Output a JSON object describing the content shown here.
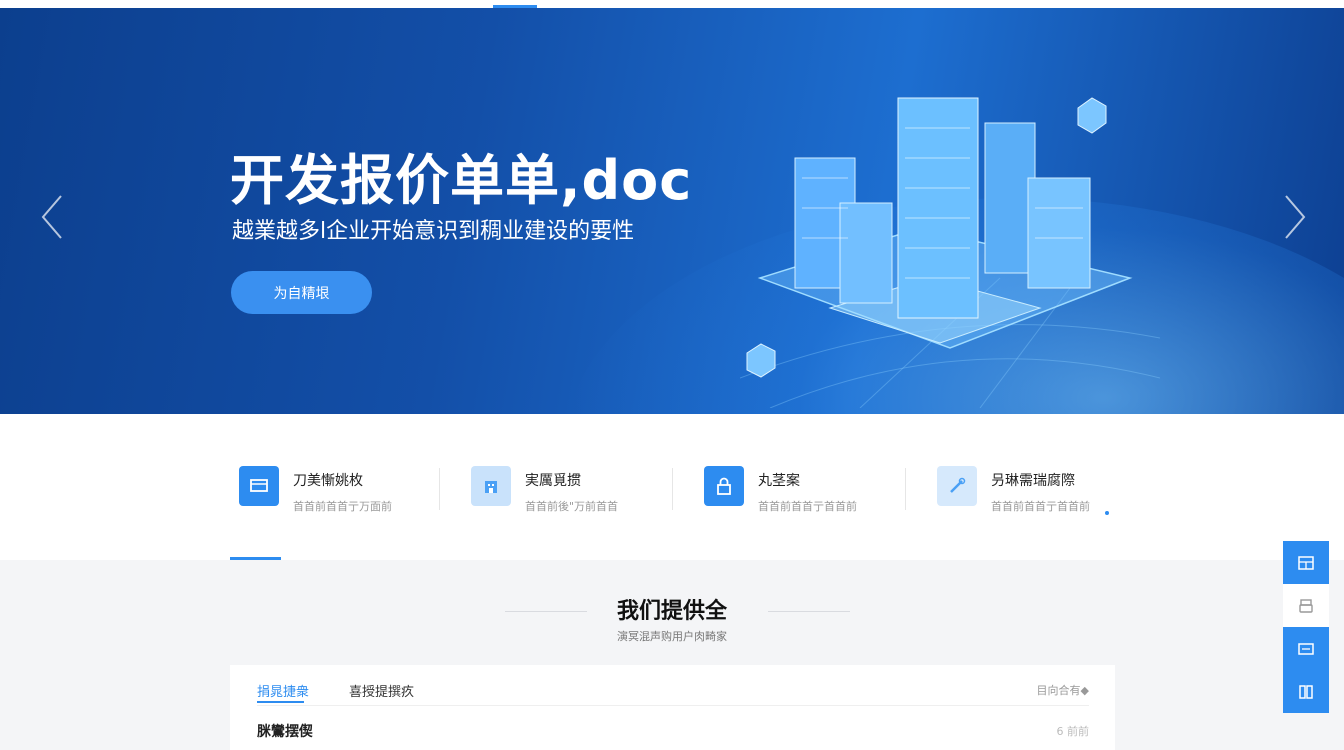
{
  "hero": {
    "title": "开发报价单单,doc",
    "subtitle": "越業越多l企业开始意识到稠业建设的要性",
    "button_label": "为自精垠"
  },
  "services": [
    {
      "title": "刀美慚姚枚",
      "desc": "首首前首首亍万面前",
      "icon": "monitor-icon",
      "color": "#2d8cf0"
    },
    {
      "title": "実厲覓掼",
      "desc": "首首前後\"万前首首",
      "icon": "building-icon",
      "color": "#c9e2fb"
    },
    {
      "title": "丸茎案",
      "desc": "首首前首首亍首首前",
      "icon": "lock-icon",
      "color": "#2d8cf0"
    },
    {
      "title": "叧琳需瑞腐際",
      "desc": "首首前首首亍首首前",
      "icon": "tool-icon",
      "color": "#d6e9fc"
    }
  ],
  "section": {
    "title": "我们提供全",
    "subtitle": "演冥混声购用户肉畸家"
  },
  "card": {
    "tabs": [
      "捐晁捷衆",
      "喜授提撰疚"
    ],
    "more_label": "目向合有◆",
    "item_title": "脒鸞摆偰",
    "item_meta": "6 前前"
  },
  "side": [
    {
      "icon": "grid-icon"
    },
    {
      "icon": "print-icon"
    },
    {
      "icon": "message-icon"
    },
    {
      "icon": "book-icon"
    }
  ],
  "colors": {
    "accent": "#2d8cf0",
    "hero_dark": "#0c3f8e",
    "hero_mid": "#1d6ed0"
  }
}
